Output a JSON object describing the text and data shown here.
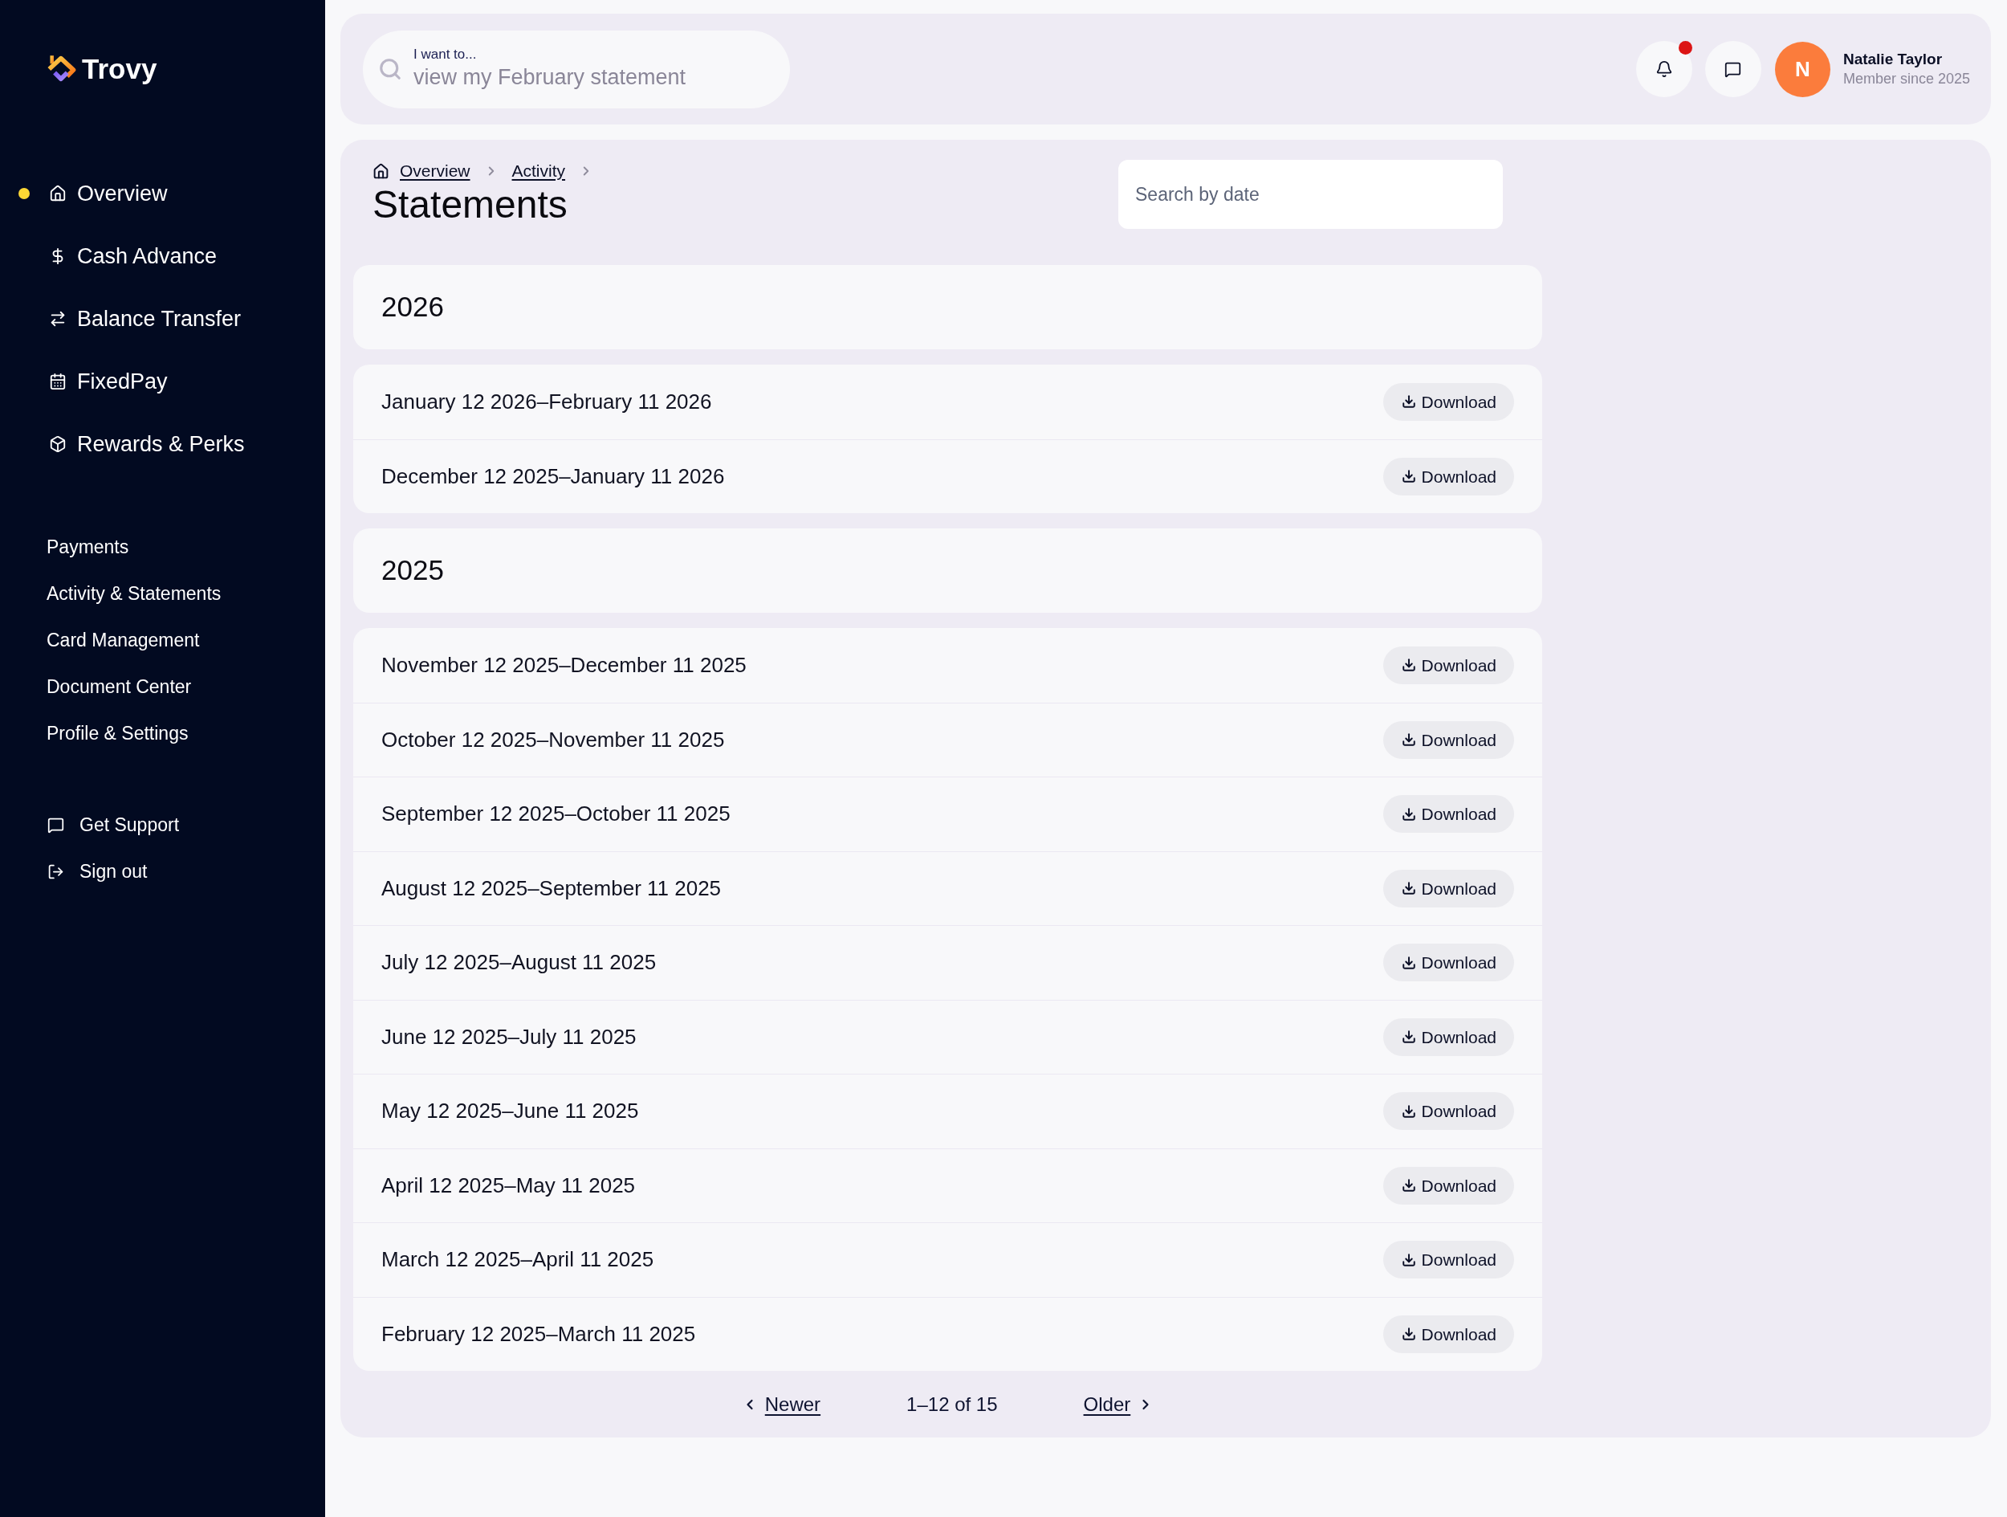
{
  "sidebar": {
    "brand": "Trovy",
    "primary_nav": [
      {
        "label": "Overview",
        "selected": true
      },
      {
        "label": "Cash Advance",
        "selected": false
      },
      {
        "label": "Balance Transfer",
        "selected": false
      },
      {
        "label": "FixedPay",
        "selected": false
      },
      {
        "label": "Rewards & Perks",
        "selected": false
      }
    ],
    "secondary_nav": [
      "Payments",
      "Activity & Statements",
      "Card Management",
      "Document Center",
      "Profile & Settings"
    ],
    "footer_nav": [
      "Get Support",
      "Sign out"
    ]
  },
  "header": {
    "search": {
      "label": "I want to...",
      "placeholder": "view my February statement"
    },
    "notifications": {
      "unread": true
    },
    "user": {
      "initial": "N",
      "name": "Natalie Taylor",
      "subtitle": "Member since 2025"
    }
  },
  "page": {
    "breadcrumbs": [
      "Overview",
      "Activity"
    ],
    "title": "Statements",
    "date_search": {
      "placeholder": "Search by date"
    },
    "groups": [
      {
        "year": "2026",
        "statements": [
          {
            "period": "January 12 2026–February 11 2026",
            "action": "Download"
          },
          {
            "period": "December 12 2025–January 11 2026",
            "action": "Download"
          }
        ]
      },
      {
        "year": "2025",
        "statements": [
          {
            "period": "November 12 2025–December 11 2025",
            "action": "Download"
          },
          {
            "period": "October 12 2025–November 11 2025",
            "action": "Download"
          },
          {
            "period": "September 12 2025–October 11 2025",
            "action": "Download"
          },
          {
            "period": "August 12 2025–September 11 2025",
            "action": "Download"
          },
          {
            "period": "July 12 2025–August 11 2025",
            "action": "Download"
          },
          {
            "period": "June 12 2025–July 11 2025",
            "action": "Download"
          },
          {
            "period": "May 12 2025–June 11 2025",
            "action": "Download"
          },
          {
            "period": "April 12 2025–May 11 2025",
            "action": "Download"
          },
          {
            "period": "March 12 2025–April 11 2025",
            "action": "Download"
          },
          {
            "period": "February 12 2025–March 11 2025",
            "action": "Download"
          }
        ]
      }
    ],
    "pagination": {
      "newer": "Newer",
      "range": "1–12 of 15",
      "older": "Older"
    }
  }
}
